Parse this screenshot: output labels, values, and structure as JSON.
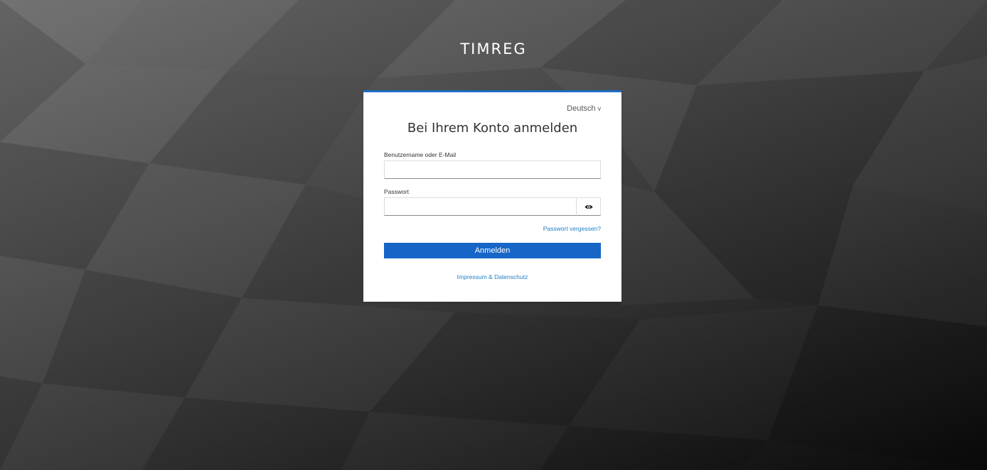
{
  "brand": {
    "title": "TIMREG"
  },
  "login": {
    "language": "Deutsch",
    "heading": "Bei Ihrem Konto anmelden",
    "username_label": "Benutzername oder E-Mail",
    "username_value": "",
    "password_label": "Passwort",
    "password_value": "",
    "forgot_password": "Passwort vergessen?",
    "submit_label": "Anmelden",
    "footer_link": "Impressum & Datenschutz"
  },
  "icons": {
    "language_dropdown": "chevron-down-icon",
    "password_toggle": "eye-icon"
  },
  "colors": {
    "accent": "#1766c7",
    "card_top_border": "#1d6ec4",
    "link": "#1d7fc4",
    "background_light": "#6a6a6a",
    "background_dark": "#0a0a0a"
  }
}
